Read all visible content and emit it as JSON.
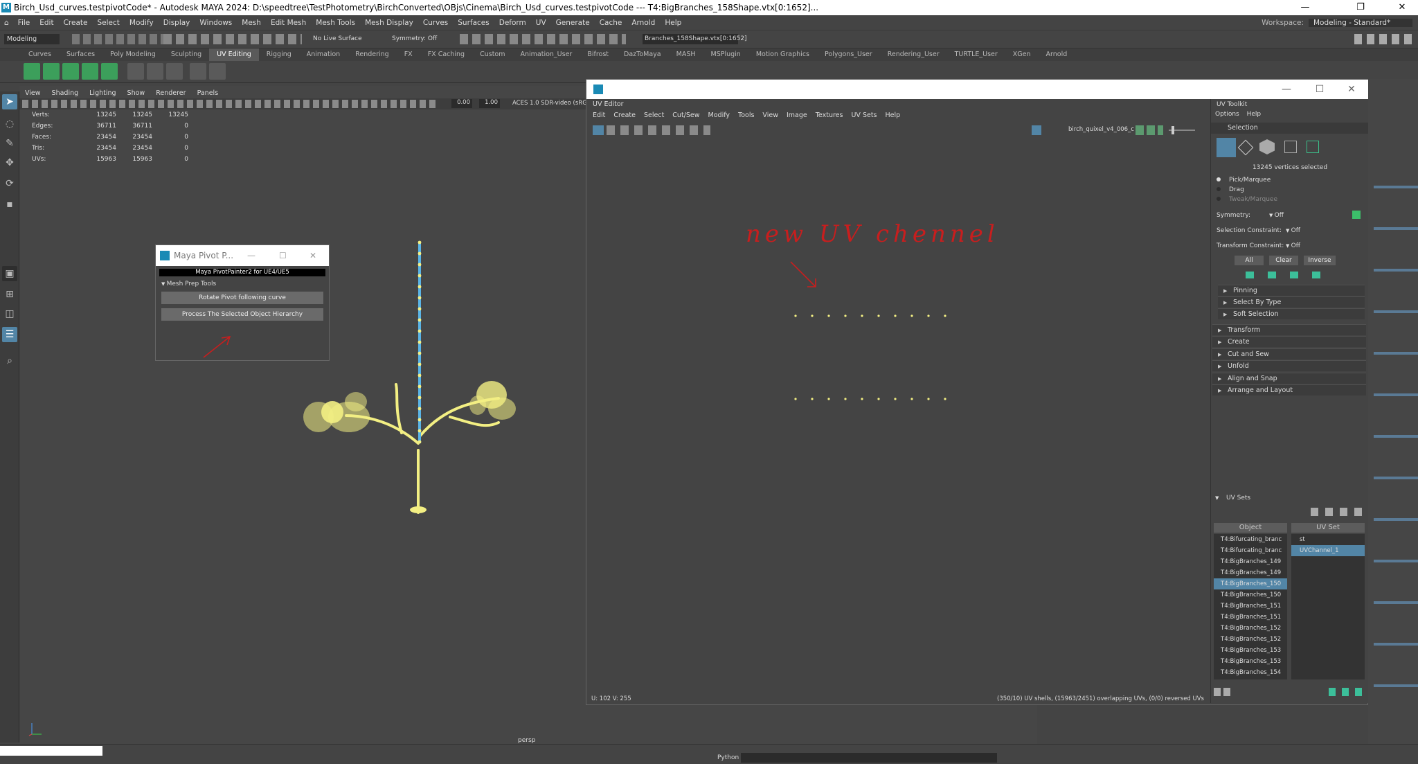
{
  "window": {
    "title": "Birch_Usd_curves.testpivotCode* - Autodesk MAYA 2024: D:\\speedtree\\TestPhotometry\\BirchConverted\\OBjs\\Cinema\\Birch_Usd_curves.testpivotCode   ---   T4:BigBranches_158Shape.vtx[0:1652]...",
    "controls": [
      "—",
      "❐",
      "✕"
    ]
  },
  "menubar": [
    "File",
    "Edit",
    "Create",
    "Select",
    "Modify",
    "Display",
    "Windows",
    "Mesh",
    "Edit Mesh",
    "Mesh Tools",
    "Mesh Display",
    "Curves",
    "Surfaces",
    "Deform",
    "UV",
    "Generate",
    "Cache",
    "Arnold",
    "Help"
  ],
  "workspace": {
    "label": "Workspace:",
    "value": "Modeling - Standard*"
  },
  "statusline": {
    "mode": "Modeling",
    "live_surface": "No Live Surface",
    "symmetry": "Symmetry: Off",
    "selection_field": "Branches_158Shape.vtx[0:1652]"
  },
  "shelf_tabs": [
    "Curves",
    "Surfaces",
    "Poly Modeling",
    "Sculpting",
    "UV Editing",
    "Rigging",
    "Animation",
    "Rendering",
    "FX",
    "FX Caching",
    "Custom",
    "Animation_User",
    "Bifrost",
    "DazToMaya",
    "MASH",
    "MSPlugin",
    "Motion Graphics",
    "Polygons_User",
    "Rendering_User",
    "TURTLE_User",
    "XGen",
    "Arnold"
  ],
  "shelf_active": "UV Editing",
  "viewport": {
    "menu": [
      "View",
      "Shading",
      "Lighting",
      "Show",
      "Renderer",
      "Panels"
    ],
    "field_a": "0.00",
    "field_b": "1.00",
    "colorspace": "ACES 1.0 SDR-video (sRGB",
    "camera": "persp"
  },
  "hud": {
    "rows": [
      {
        "label": "Verts:",
        "a": "13245",
        "b": "13245",
        "c": "13245"
      },
      {
        "label": "Edges:",
        "a": "36711",
        "b": "36711",
        "c": "0"
      },
      {
        "label": "Faces:",
        "a": "23454",
        "b": "23454",
        "c": "0"
      },
      {
        "label": "Tris:",
        "a": "23454",
        "b": "23454",
        "c": "0"
      },
      {
        "label": "UVs:",
        "a": "15963",
        "b": "15963",
        "c": "0"
      }
    ]
  },
  "pivot_painter": {
    "title": "Maya Pivot P...",
    "header": "Maya PivotPainter2 for UE4/UE5",
    "section": "Mesh Prep Tools",
    "btn_rotate": "Rotate Pivot following curve",
    "btn_process": "Process The Selected Object Hierarchy"
  },
  "uv_editor": {
    "window_label": "UV Editor",
    "menu": [
      "Edit",
      "Create",
      "Select",
      "Cut/Sew",
      "Modify",
      "Tools",
      "View",
      "Image",
      "Textures",
      "UV Sets",
      "Help"
    ],
    "texture_name": "birch_quixel_v4_006_c",
    "coords": "U:  102 V:  255",
    "shell_info": "(350/10) UV shells, (15963/2451) overlapping UVs, (0/0) reversed UVs",
    "annotation": "new UV chennel"
  },
  "uv_toolkit": {
    "title": "UV Toolkit",
    "menu": [
      "Options",
      "Help"
    ],
    "selection_header": "Selection",
    "selected_info": "13245 vertices selected",
    "modes": [
      "Pick/Marquee",
      "Drag",
      "Tweak/Marquee"
    ],
    "symmetry": {
      "label": "Symmetry:",
      "value": "Off"
    },
    "sel_constraint": {
      "label": "Selection Constraint:",
      "value": "Off"
    },
    "xform_constraint": {
      "label": "Transform Constraint:",
      "value": "Off"
    },
    "btn_all": "All",
    "btn_clear": "Clear",
    "btn_inverse": "Inverse",
    "subsections": [
      "Pinning",
      "Select By Type",
      "Soft Selection"
    ],
    "sections": [
      "Transform",
      "Create",
      "Cut and Sew",
      "Unfold",
      "Align and Snap",
      "Arrange and Layout"
    ],
    "uvsets_header": "UV Sets",
    "col_object": "Object",
    "col_uvset": "UV Set",
    "objects": [
      "T4:Bifurcating_branc",
      "T4:Bifurcating_branc",
      "T4:BigBranches_149",
      "T4:BigBranches_149",
      "T4:BigBranches_150",
      "T4:BigBranches_150",
      "T4:BigBranches_151",
      "T4:BigBranches_151",
      "T4:BigBranches_152",
      "T4:BigBranches_152",
      "T4:BigBranches_153",
      "T4:BigBranches_153",
      "T4:BigBranches_154"
    ],
    "selected_object_index": 4,
    "uvsets": [
      "st",
      "UVChannel_1"
    ],
    "selected_uvset_index": 1
  },
  "bottom": {
    "label": "Python"
  },
  "colors": {
    "accent": "#5285a6",
    "selection_yellow": "#f3ef83",
    "curve_blue": "#5ab4e6",
    "annotation_red": "#c81e1e"
  }
}
